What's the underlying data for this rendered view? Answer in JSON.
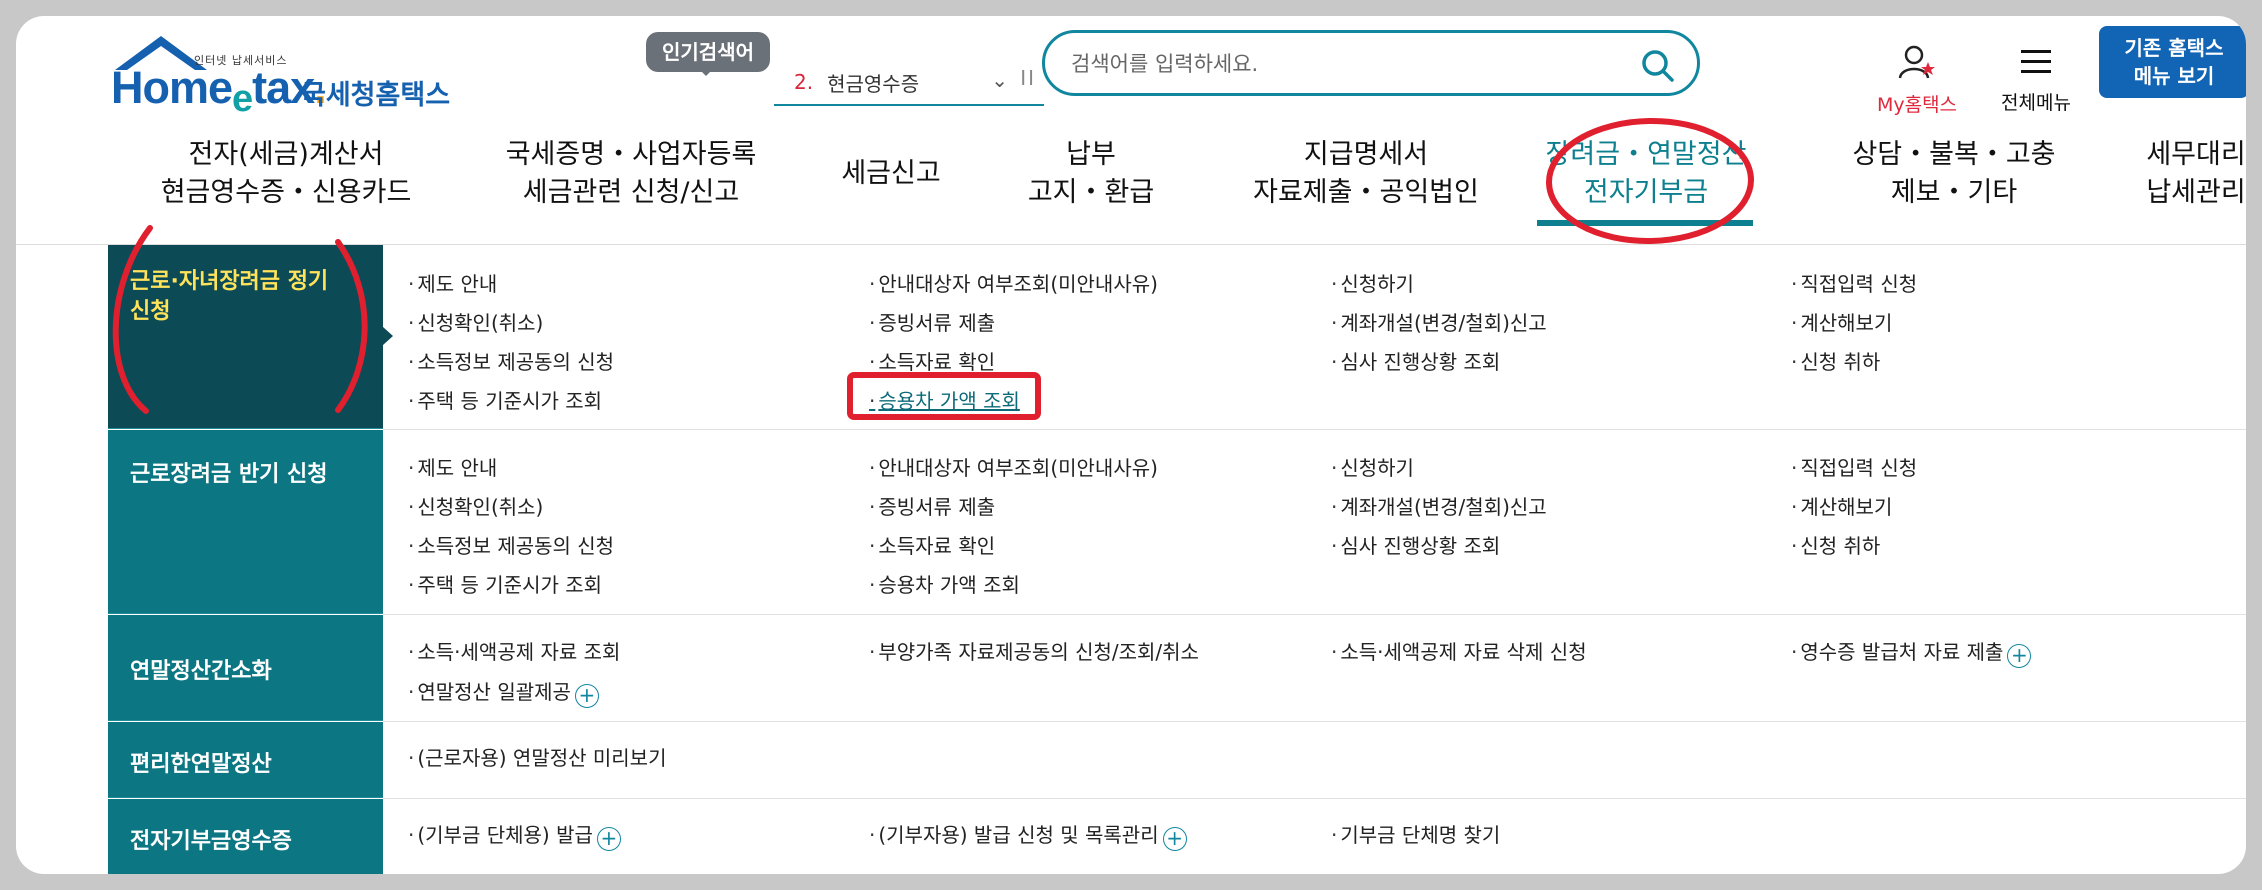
{
  "logo": {
    "tagline": "인터넷 납세서비스",
    "name_en": "Home",
    "name_e": "e",
    "name_tax": "tax",
    "dot": ".",
    "name_ko": "국세청홈택스"
  },
  "popular": {
    "badge": "인기검색어",
    "rank": "2.",
    "term": "현금영수증"
  },
  "search": {
    "placeholder": "검색어를 입력하세요."
  },
  "util": {
    "myhome": "My홈택스",
    "allmenu": "전체메뉴",
    "classic": "기존 홈택스\n메뉴 보기"
  },
  "gnb": [
    "전자(세금)계산서\n현금영수증・신용카드",
    "국세증명・사업자등록\n세금관련 신청/신고",
    "세금신고",
    "납부\n고지・환급",
    "지급명세서\n자료제출・공익법인",
    "장려금・연말정산\n전자기부금",
    "상담・불복・고충\n제보・기타",
    "세무대리\n납세관리"
  ],
  "sections": [
    {
      "title": "근로·자녀장려금 정기\n신청",
      "col1": [
        "제도 안내",
        "신청확인(취소)",
        "소득정보 제공동의 신청",
        "주택 등 기준시가 조회"
      ],
      "col2": [
        "안내대상자 여부조회(미안내사유)",
        "증빙서류 제출",
        "소득자료 확인",
        "승용차 가액 조회"
      ],
      "col3": [
        "신청하기",
        "계좌개설(변경/철회)신고",
        "심사 진행상황 조회"
      ],
      "col4": [
        "직접입력 신청",
        "계산해보기",
        "신청 취하"
      ]
    },
    {
      "title": "근로장려금 반기 신청",
      "col1": [
        "제도 안내",
        "신청확인(취소)",
        "소득정보 제공동의 신청",
        "주택 등 기준시가 조회"
      ],
      "col2": [
        "안내대상자 여부조회(미안내사유)",
        "증빙서류 제출",
        "소득자료 확인",
        "승용차 가액 조회"
      ],
      "col3": [
        "신청하기",
        "계좌개설(변경/철회)신고",
        "심사 진행상황 조회"
      ],
      "col4": [
        "직접입력 신청",
        "계산해보기",
        "신청 취하"
      ]
    },
    {
      "title": "연말정산간소화",
      "col1": [
        "소득·세액공제 자료 조회",
        "연말정산 일괄제공"
      ],
      "col2": [
        "부양가족 자료제공동의 신청/조회/취소"
      ],
      "col3": [
        "소득·세액공제 자료 삭제 신청"
      ],
      "col4": [
        "영수증 발급처 자료 제출"
      ]
    },
    {
      "title": "편리한연말정산",
      "col1": [
        "(근로자용) 연말정산 미리보기"
      ]
    },
    {
      "title": "전자기부금영수증",
      "col1": [
        "(기부금 단체용) 발급"
      ],
      "col2": [
        "(기부자용) 발급 신청 및 목록관리"
      ],
      "col3": [
        "기부금 단체명 찾기"
      ]
    }
  ],
  "colors": {
    "teal": "#0c7682",
    "teal_dark": "#0c4a55",
    "active_yellow": "#ffe35a",
    "brand_blue": "#1264b4",
    "annotation_red": "#e0202e"
  }
}
